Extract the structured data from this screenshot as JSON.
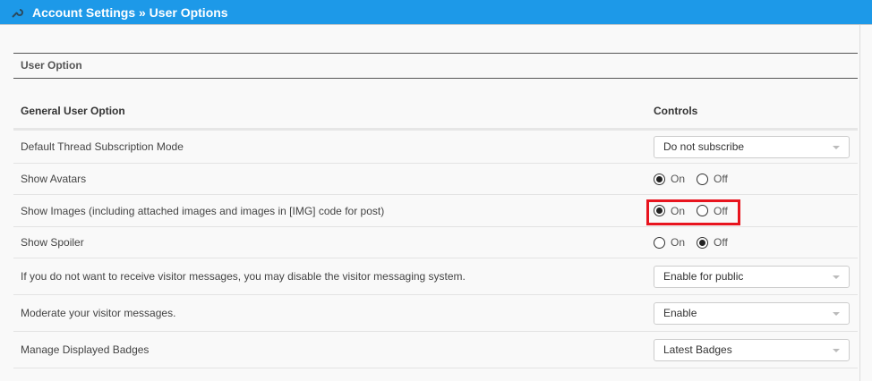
{
  "header": {
    "title": "Account Settings » User Options",
    "icon": "wrench-icon"
  },
  "section": {
    "title": "User Option"
  },
  "table": {
    "col1": "General User Option",
    "col2": "Controls"
  },
  "rows": [
    {
      "label": "Default Thread Subscription Mode",
      "type": "select",
      "value": "Do not subscribe"
    },
    {
      "label": "Show Avatars",
      "type": "radio",
      "on": "On",
      "off": "Off",
      "selected": "On"
    },
    {
      "label": "Show Images (including attached images and images in [IMG] code for post)",
      "type": "radio",
      "on": "On",
      "off": "Off",
      "selected": "On"
    },
    {
      "label": "Show Spoiler",
      "type": "radio",
      "on": "On",
      "off": "Off",
      "selected": "Off"
    },
    {
      "label": "If you do not want to receive visitor messages, you may disable the visitor messaging system.",
      "type": "select",
      "value": "Enable for public"
    },
    {
      "label": "Moderate your visitor messages.",
      "type": "select",
      "value": "Enable"
    },
    {
      "label": "Manage Displayed Badges",
      "type": "select",
      "value": "Latest Badges"
    }
  ],
  "highlight_color": "#e8141e"
}
